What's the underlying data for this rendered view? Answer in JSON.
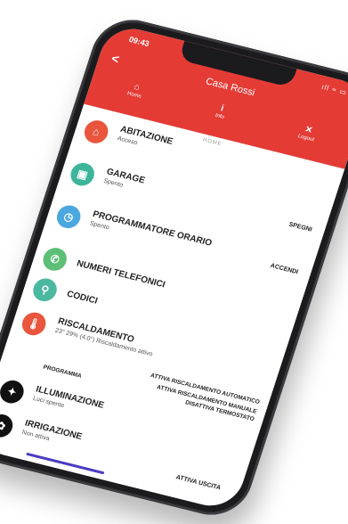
{
  "status_bar": {
    "time": "09:43",
    "icons": "ıll ≈ ▭"
  },
  "header": {
    "back": "<",
    "title": "Casa Rossi",
    "tabs": [
      {
        "icon": "home-icon",
        "glyph": "⌂",
        "label": "Home"
      },
      {
        "icon": "info-icon",
        "glyph": "i",
        "label": "Info"
      },
      {
        "icon": "close-icon",
        "glyph": "✕",
        "label": "Logout"
      }
    ]
  },
  "home_hint": "HOME",
  "items": [
    {
      "key": "abitazione",
      "name": "ABITAZIONE",
      "status": "Acceso",
      "color": "#e9553d",
      "glyph": "⌂",
      "action": ""
    },
    {
      "key": "garage",
      "name": "GARAGE",
      "status": "Spento",
      "color": "#3cb59a",
      "glyph": "▣",
      "action": "SPEGNI"
    },
    {
      "key": "programmatore",
      "name": "PROGRAMMATORE ORARIO",
      "status": "Spento",
      "color": "#4aa7df",
      "glyph": "◷",
      "action": "ACCENDI"
    },
    {
      "key": "numeri",
      "name": "NUMERI TELEFONICI",
      "status": "",
      "color": "#5cbf75",
      "glyph": "✆",
      "action": ""
    },
    {
      "key": "codici",
      "name": "CODICI",
      "status": "",
      "color": "#4bb8a0",
      "glyph": "⚲",
      "action": ""
    }
  ],
  "riscaldamento": {
    "name": "RISCALDAMENTO",
    "status": "23° 29% (4.0°) Riscaldamento attivo",
    "color": "#e9553d",
    "glyph": "🌡",
    "actions": {
      "auto": "ATTIVA RISCALDAMENTO AUTOMATICO",
      "manual": "ATTIVA RISCALDAMENTO MANUALE",
      "program": "PROGRAMMA",
      "disable_thermo": "DISATTIVA TERMOSTATO"
    }
  },
  "illuminazione": {
    "name": "ILLUMINAZIONE",
    "status": "Luci spente",
    "color": "#111111",
    "glyph": "✦"
  },
  "irrigazione": {
    "name": "IRRIGAZIONE",
    "status": "Non attiva",
    "color": "#111111",
    "glyph": "✿"
  },
  "bottom": {
    "action": "ATTIVA USCITA"
  }
}
